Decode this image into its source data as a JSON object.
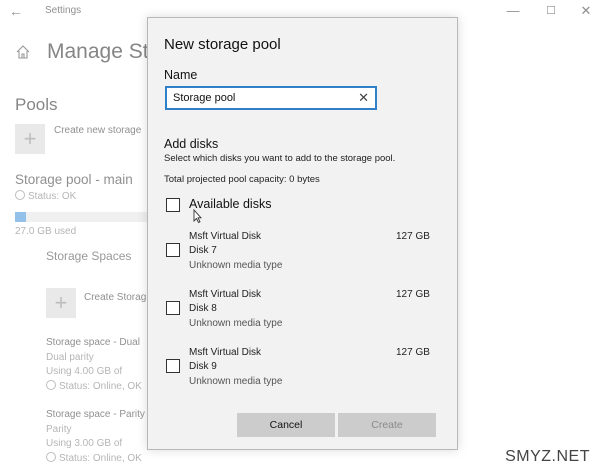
{
  "window": {
    "title": "Settings",
    "controls": [
      "minimize-icon",
      "maximize-icon",
      "close-icon"
    ]
  },
  "background": {
    "heading": "Manage Sto",
    "pools_heading": "Pools",
    "create_pool_label": "Create new storage",
    "pool": {
      "name": "Storage pool - main",
      "status": "Status: OK",
      "used": "27.0 GB used",
      "usage_fraction": 0.08
    },
    "storage_spaces_heading": "Storage Spaces",
    "create_space_label": "Create Storag",
    "spaces": [
      {
        "name": "Storage space - Dual",
        "type": "Dual parity",
        "usage": "Using 4.00 GB of",
        "status": "Status: Online, OK"
      },
      {
        "name": "Storage space - Parity",
        "type": "Parity",
        "usage": "Using 3.00 GB of",
        "status": "Status: Online, OK"
      }
    ]
  },
  "dialog": {
    "title": "New storage pool",
    "name_label": "Name",
    "name_value": "Storage pool",
    "add_disks_heading": "Add disks",
    "description": "Select which disks you want to add to the storage pool.",
    "capacity": "Total projected pool capacity: 0 bytes",
    "available_label": "Available disks",
    "disks": [
      {
        "name": "Msft Virtual Disk",
        "id": "Disk 7",
        "media": "Unknown media type",
        "size": "127 GB",
        "checked": false
      },
      {
        "name": "Msft Virtual Disk",
        "id": "Disk 8",
        "media": "Unknown media type",
        "size": "127 GB",
        "checked": false
      },
      {
        "name": "Msft Virtual Disk",
        "id": "Disk 9",
        "media": "Unknown media type",
        "size": "127 GB",
        "checked": false
      }
    ],
    "cancel_label": "Cancel",
    "create_label": "Create"
  },
  "watermark": "SMYZ.NET",
  "colors": {
    "accent": "#2f80c8",
    "usage_fill": "#3b8ed8",
    "dialog_bg": "#f2f2f2",
    "button_bg": "#cccccc"
  }
}
